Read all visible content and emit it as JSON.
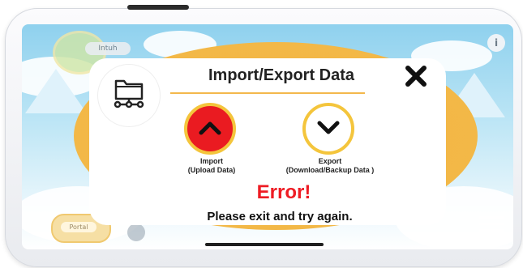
{
  "background": {
    "info_glyph": "i",
    "tag_label": "Intuh",
    "bottom_button_label": "Portal"
  },
  "dialog": {
    "title": "Import/Export Data",
    "icon": "folder-network-icon",
    "close_icon": "close-x-icon",
    "import": {
      "label_line1": "Import",
      "label_line2": "(Upload Data)",
      "icon": "chevron-up-icon",
      "color": "#ea1b21"
    },
    "export": {
      "label_line1": "Export",
      "label_line2": "(Download/Backup Data )",
      "icon": "chevron-down-icon",
      "color": "#ffffff"
    },
    "error_title": "Error!",
    "error_message": "Please exit and try again.",
    "accent_color": "#f4c53c",
    "error_color": "#ee1c24"
  }
}
